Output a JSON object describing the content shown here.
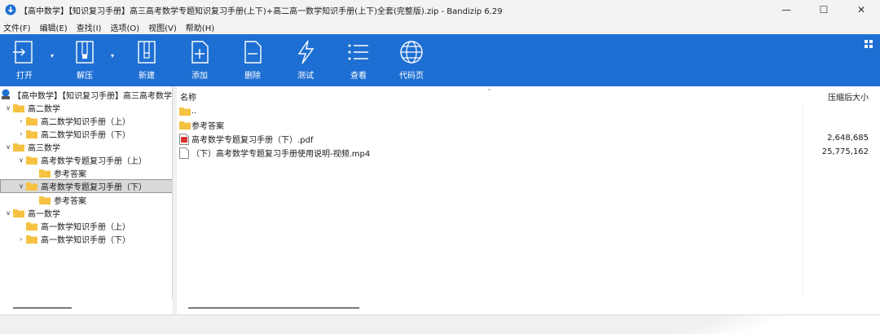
{
  "window": {
    "title": "【高中数学】【知识复习手册】高三高考数学专题知识复习手册(上下)+高二高一数学知识手册(上下)全套(完整版).zip - Bandizip 6.29",
    "minimize": "—",
    "maximize": "☐",
    "close": "✕"
  },
  "menu": [
    "文件(F)",
    "编辑(E)",
    "查找(I)",
    "选项(O)",
    "视图(V)",
    "帮助(H)"
  ],
  "toolbar": {
    "open": "打开",
    "extract": "解压",
    "new": "新建",
    "add": "添加",
    "delete": "删除",
    "test": "测试",
    "view": "查看",
    "codepage": "代码页"
  },
  "tree": {
    "root": "【高中数学】【知识复习手册】高三高考数学",
    "items": [
      {
        "label": "高二数学"
      },
      {
        "label": "高二数学知识手册（上）"
      },
      {
        "label": "高二数学知识手册（下）"
      },
      {
        "label": "高三数学"
      },
      {
        "label": "高考数学专题复习手册（上）"
      },
      {
        "label": "参考答案"
      },
      {
        "label": "高考数学专题复习手册（下）"
      },
      {
        "label": "参考答案"
      },
      {
        "label": "高一数学"
      },
      {
        "label": "高一数学知识手册（上）"
      },
      {
        "label": "高一数学知识手册（下）"
      }
    ]
  },
  "list": {
    "col_name": "名称",
    "col_size": "压缩后大小",
    "rows": [
      {
        "name": "..",
        "size": ""
      },
      {
        "name": "参考答案",
        "size": ""
      },
      {
        "name": "高考数学专题复习手册（下）.pdf",
        "size": "2,648,685"
      },
      {
        "name": "（下）高考数学专题复习手册使用说明-视频.mp4",
        "size": "25,775,162"
      }
    ]
  },
  "colors": {
    "toolbar": "#1e6fd3",
    "folder": "#f5c242",
    "pdf": "#d9342b"
  }
}
